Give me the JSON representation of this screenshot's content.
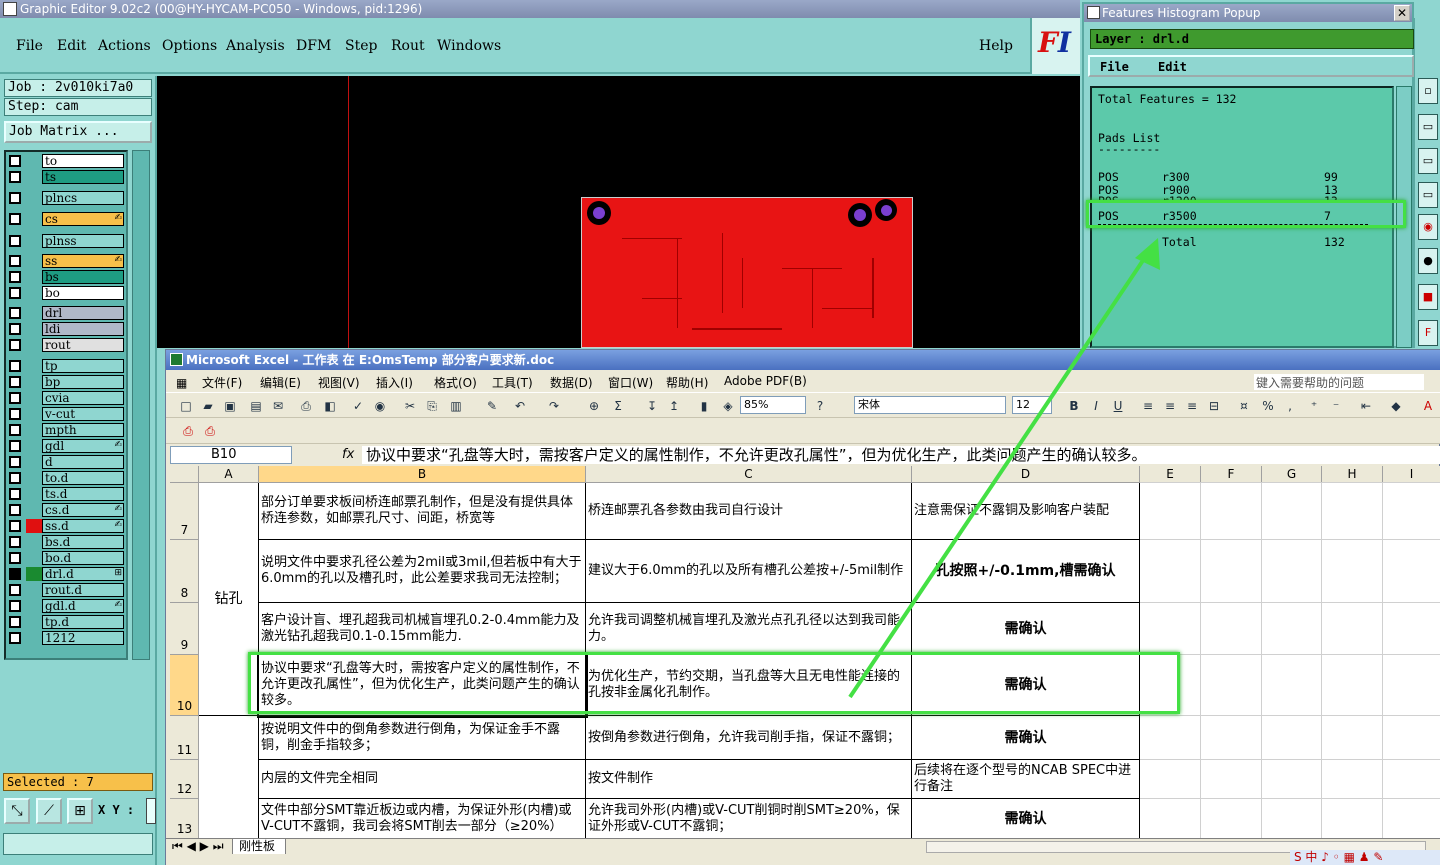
{
  "ge": {
    "title": "Graphic Editor 9.02c2 (00@HY-HYCAM-PC050 - Windows, pid:1296)",
    "menu": [
      "File",
      "Edit",
      "Actions",
      "Options",
      "Analysis",
      "DFM",
      "Step",
      "Rout",
      "Windows"
    ],
    "help": "Help",
    "logo_a": "F",
    "logo_b": "I",
    "job": "Job : 2v010ki7a0",
    "step": "Step: cam",
    "job_matrix": "Job Matrix ...",
    "layers": [
      {
        "name": "to",
        "color": "#ffffff",
        "badge": "",
        "mark": ""
      },
      {
        "name": "ts",
        "color": "#1e9c82",
        "badge": "",
        "mark": ""
      },
      {
        "name": "plncs",
        "color": "#8fd6d0",
        "badge": "",
        "mark": ""
      },
      {
        "name": "cs",
        "color": "#f7c04a",
        "badge": "✍",
        "mark": ""
      },
      {
        "name": "plnss",
        "color": "#8fd6d0",
        "badge": "",
        "mark": ""
      },
      {
        "name": "ss",
        "color": "#f7c04a",
        "badge": "✍",
        "mark": ""
      },
      {
        "name": "bs",
        "color": "#1e9c82",
        "badge": "",
        "mark": ""
      },
      {
        "name": "bo",
        "color": "#ffffff",
        "badge": "",
        "mark": ""
      },
      {
        "name": "drl",
        "color": "#b0b8c8",
        "badge": "",
        "mark": ""
      },
      {
        "name": "ldi",
        "color": "#b0b8c8",
        "badge": "",
        "mark": ""
      },
      {
        "name": "rout",
        "color": "#e0e0e0",
        "badge": "",
        "mark": ""
      },
      {
        "name": "tp",
        "color": "#8fd6d0",
        "badge": "",
        "mark": ""
      },
      {
        "name": "bp",
        "color": "#8fd6d0",
        "badge": "",
        "mark": ""
      },
      {
        "name": "cvia",
        "color": "#8fd6d0",
        "badge": "",
        "mark": ""
      },
      {
        "name": "v-cut",
        "color": "#8fd6d0",
        "badge": "",
        "mark": ""
      },
      {
        "name": "mpth",
        "color": "#8fd6d0",
        "badge": "",
        "mark": ""
      },
      {
        "name": "gdl",
        "color": "#8fd6d0",
        "badge": "✍",
        "mark": ""
      },
      {
        "name": "d",
        "color": "#8fd6d0",
        "badge": "",
        "mark": ""
      },
      {
        "name": "to.d",
        "color": "#8fd6d0",
        "badge": "",
        "mark": ""
      },
      {
        "name": "ts.d",
        "color": "#8fd6d0",
        "badge": "",
        "mark": ""
      },
      {
        "name": "cs.d",
        "color": "#8fd6d0",
        "badge": "✍",
        "mark": ""
      },
      {
        "name": "ss.d",
        "color": "#8fd6d0",
        "badge": "✍",
        "mark": "#e01010"
      },
      {
        "name": "bs.d",
        "color": "#8fd6d0",
        "badge": "",
        "mark": ""
      },
      {
        "name": "bo.d",
        "color": "#8fd6d0",
        "badge": "",
        "mark": ""
      },
      {
        "name": "drl.d",
        "color": "#8fd6d0",
        "badge": "⊞",
        "mark": "#1a8a30"
      },
      {
        "name": "rout.d",
        "color": "#8fd6d0",
        "badge": "",
        "mark": ""
      },
      {
        "name": "gdl.d",
        "color": "#8fd6d0",
        "badge": "✍",
        "mark": ""
      },
      {
        "name": "tp.d",
        "color": "#8fd6d0",
        "badge": "",
        "mark": ""
      },
      {
        "name": "1212",
        "color": "#8fd6d0",
        "badge": "",
        "mark": ""
      }
    ],
    "selected": "Selected : 7",
    "xy": "X Y :"
  },
  "histogram": {
    "title": "Features Histogram Popup",
    "layer": "Layer :  drl.d",
    "menu": [
      "File",
      "Edit"
    ],
    "total_line": "Total Features = 132",
    "pads_header": "Pads List",
    "rule": "---------",
    "rows": [
      {
        "kind": "POS",
        "sym": "r300",
        "count": "99"
      },
      {
        "kind": "POS",
        "sym": "r900",
        "count": "13"
      },
      {
        "kind": "POS",
        "sym": "r1200",
        "count": "13"
      },
      {
        "kind": "POS",
        "sym": "r3500",
        "count": "7"
      }
    ],
    "total_label": "Total",
    "total_value": "132"
  },
  "excel": {
    "title": "Microsoft Excel - 工作表 在 E:OmsTemp 部分客户要求新.doc",
    "menu": [
      "文件(F)",
      "编辑(E)",
      "视图(V)",
      "插入(I)",
      "格式(O)",
      "工具(T)",
      "数据(D)",
      "窗口(W)",
      "帮助(H)",
      "Adobe PDF(B)"
    ],
    "help_placeholder": "键入需要帮助的问题",
    "zoom": "85%",
    "font": "宋体",
    "font_size": "12",
    "name_box": "B10",
    "fx": "fx",
    "formula": "协议中要求“孔盘等大时，需按客户定义的属性制作，不允许更改孔属性”，但为优化生产，此类问题产生的确认较多。",
    "columns": [
      "A",
      "B",
      "C",
      "D",
      "E",
      "F",
      "G",
      "H",
      "I"
    ],
    "category": "钻孔",
    "rows": [
      {
        "num": "7",
        "b": "部分订单要求板间桥连邮票孔制作，但是没有提供具体桥连参数，如邮票孔尺寸、间距，桥宽等",
        "c": "桥连邮票孔各参数由我司自行设计",
        "d": "注意需保证不露铜及影响客户装配",
        "d_center": false
      },
      {
        "num": "8",
        "b": "说明文件中要求孔径公差为2mil或3mil,但若板中有大于6.0mm的孔以及槽孔时，此公差要求我司无法控制；",
        "c": "建议大于6.0mm的孔以及所有槽孔公差按+/-5mil制作",
        "d": "孔按照+/-0.1mm,槽需确认",
        "d_center": true
      },
      {
        "num": "9",
        "b": "客户设计盲、埋孔超我司机械盲埋孔0.2-0.4mm能力及激光钻孔超我司0.1-0.15mm能力.",
        "c": "允许我司调整机械盲埋孔及激光点孔孔径以达到我司能力。",
        "d": "需确认",
        "d_center": true
      },
      {
        "num": "10",
        "b": "协议中要求“孔盘等大时，需按客户定义的属性制作，不允许更改孔属性”，但为优化生产，此类问题产生的确认较多。",
        "c": "为优化生产，节约交期，当孔盘等大且无电性能连接的孔按非金属化孔制作。",
        "d": "需确认",
        "d_center": true
      },
      {
        "num": "11",
        "b": "按说明文件中的倒角参数进行倒角，为保证金手不露铜，削金手指较多；",
        "c": "按倒角参数进行倒角，允许我司削手指，保证不露铜；",
        "d": "需确认",
        "d_center": true
      },
      {
        "num": "12",
        "b": "内层的文件完全相同",
        "c": "按文件制作",
        "d": "后续将在逐个型号的NCAB SPEC中进行备注",
        "d_center": false
      },
      {
        "num": "13",
        "b": "文件中部分SMT靠近板边或内槽，为保证外形(内槽)或V-CUT不露铜，我司会将SMT削去一部分（≥20%）",
        "c": "允许我司外形(内槽)或V-CUT削铜时削SMT≥20%，保证外形或V-CUT不露铜；",
        "d": "需确认",
        "d_center": true
      }
    ],
    "sheet_tab": "刚性板"
  },
  "taskbar": "S 中 ♪ ◦ ▦ ♟ ✎"
}
